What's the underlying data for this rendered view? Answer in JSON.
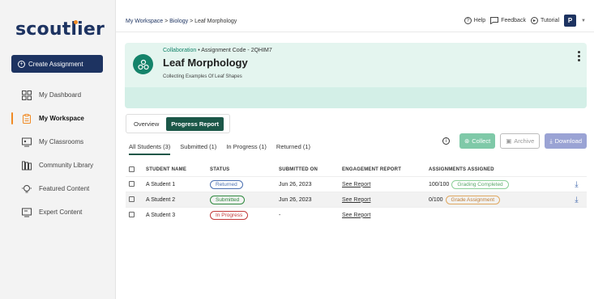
{
  "sidebar": {
    "logo": "scoutlier",
    "create_label": "Create Assignment",
    "items": [
      {
        "label": "My Dashboard",
        "icon": "dashboard-icon"
      },
      {
        "label": "My Workspace",
        "icon": "clipboard-icon"
      },
      {
        "label": "My Classrooms",
        "icon": "classroom-icon"
      },
      {
        "label": "Community Library",
        "icon": "library-icon"
      },
      {
        "label": "Featured Content",
        "icon": "bulb-icon"
      },
      {
        "label": "Expert Content",
        "icon": "board-icon"
      }
    ]
  },
  "breadcrumb": [
    "My Workspace",
    "Biology",
    "Leaf Morphology"
  ],
  "topbar": {
    "help": "Help",
    "feedback": "Feedback",
    "tutorial": "Tutorial",
    "avatar": "P"
  },
  "assignment": {
    "type": "Collaboration",
    "code": "Assignment Code - 2QHIM7",
    "title": "Leaf Morphology",
    "subtitle": "Collecting Examples Of Leaf Shapes"
  },
  "view_toggle": {
    "overview": "Overview",
    "progress": "Progress Report"
  },
  "filters": [
    "All Students (3)",
    "Submitted (1)",
    "In Progress (1)",
    "Returned (1)"
  ],
  "actions": {
    "collect": "Collect",
    "archive": "Archive",
    "download": "Download"
  },
  "table": {
    "headers": [
      "STUDENT NAME",
      "STATUS",
      "SUBMITTED ON",
      "ENGAGEMENT REPORT",
      "ASSIGNMENTS ASSIGNED"
    ],
    "rows": [
      {
        "name": "A Student 1",
        "status": "Returned",
        "submitted": "Jun 26, 2023",
        "report": "See Report",
        "score": "100/100",
        "grade": "Grading Completed"
      },
      {
        "name": "A Student 2",
        "status": "Submitted",
        "submitted": "Jun 26, 2023",
        "report": "See Report",
        "score": "0/100",
        "grade": "Grade Assignment"
      },
      {
        "name": "A Student 3",
        "status": "In Progress",
        "submitted": "-",
        "report": "See Report",
        "score": "",
        "grade": ""
      }
    ]
  },
  "colors": {
    "brand": "#1d3361",
    "accent": "#f08a24",
    "teal": "#14836a"
  }
}
